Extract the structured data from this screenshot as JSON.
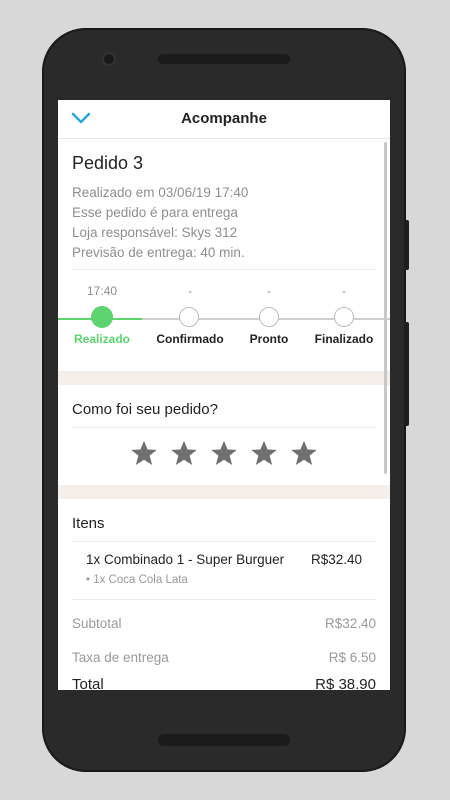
{
  "header": {
    "title": "Acompanhe",
    "back_icon": "chevron-down-icon",
    "accent": "#2aa7d8"
  },
  "order": {
    "title": "Pedido 3",
    "info": [
      "Realizado em 03/06/19 17:40",
      "Esse pedido é para entrega",
      "Loja responsável: Skys 312",
      "Previsão de entrega: 40 min."
    ]
  },
  "status": {
    "steps": [
      {
        "time": "17:40",
        "label": "Realizado",
        "active": true
      },
      {
        "time": "-",
        "label": "Confirmado",
        "active": false
      },
      {
        "time": "-",
        "label": "Pronto",
        "active": false
      },
      {
        "time": "-",
        "label": "Finalizado",
        "active": false
      }
    ],
    "active_color": "#5fd36f"
  },
  "rating": {
    "question": "Como foi seu pedido?",
    "stars": 5,
    "filled": 0
  },
  "items": {
    "title": "Itens",
    "list": [
      {
        "name": "1x Combinado 1 - Super Burguer",
        "price": "R$32.40",
        "sub": "• 1x Coca Cola Lata"
      }
    ]
  },
  "totals": {
    "subtotal_label": "Subtotal",
    "subtotal_value": "R$32.40",
    "delivery_label": "Taxa de entrega",
    "delivery_value": "R$ 6.50",
    "total_label": "Total",
    "total_value": "R$ 38.90"
  }
}
